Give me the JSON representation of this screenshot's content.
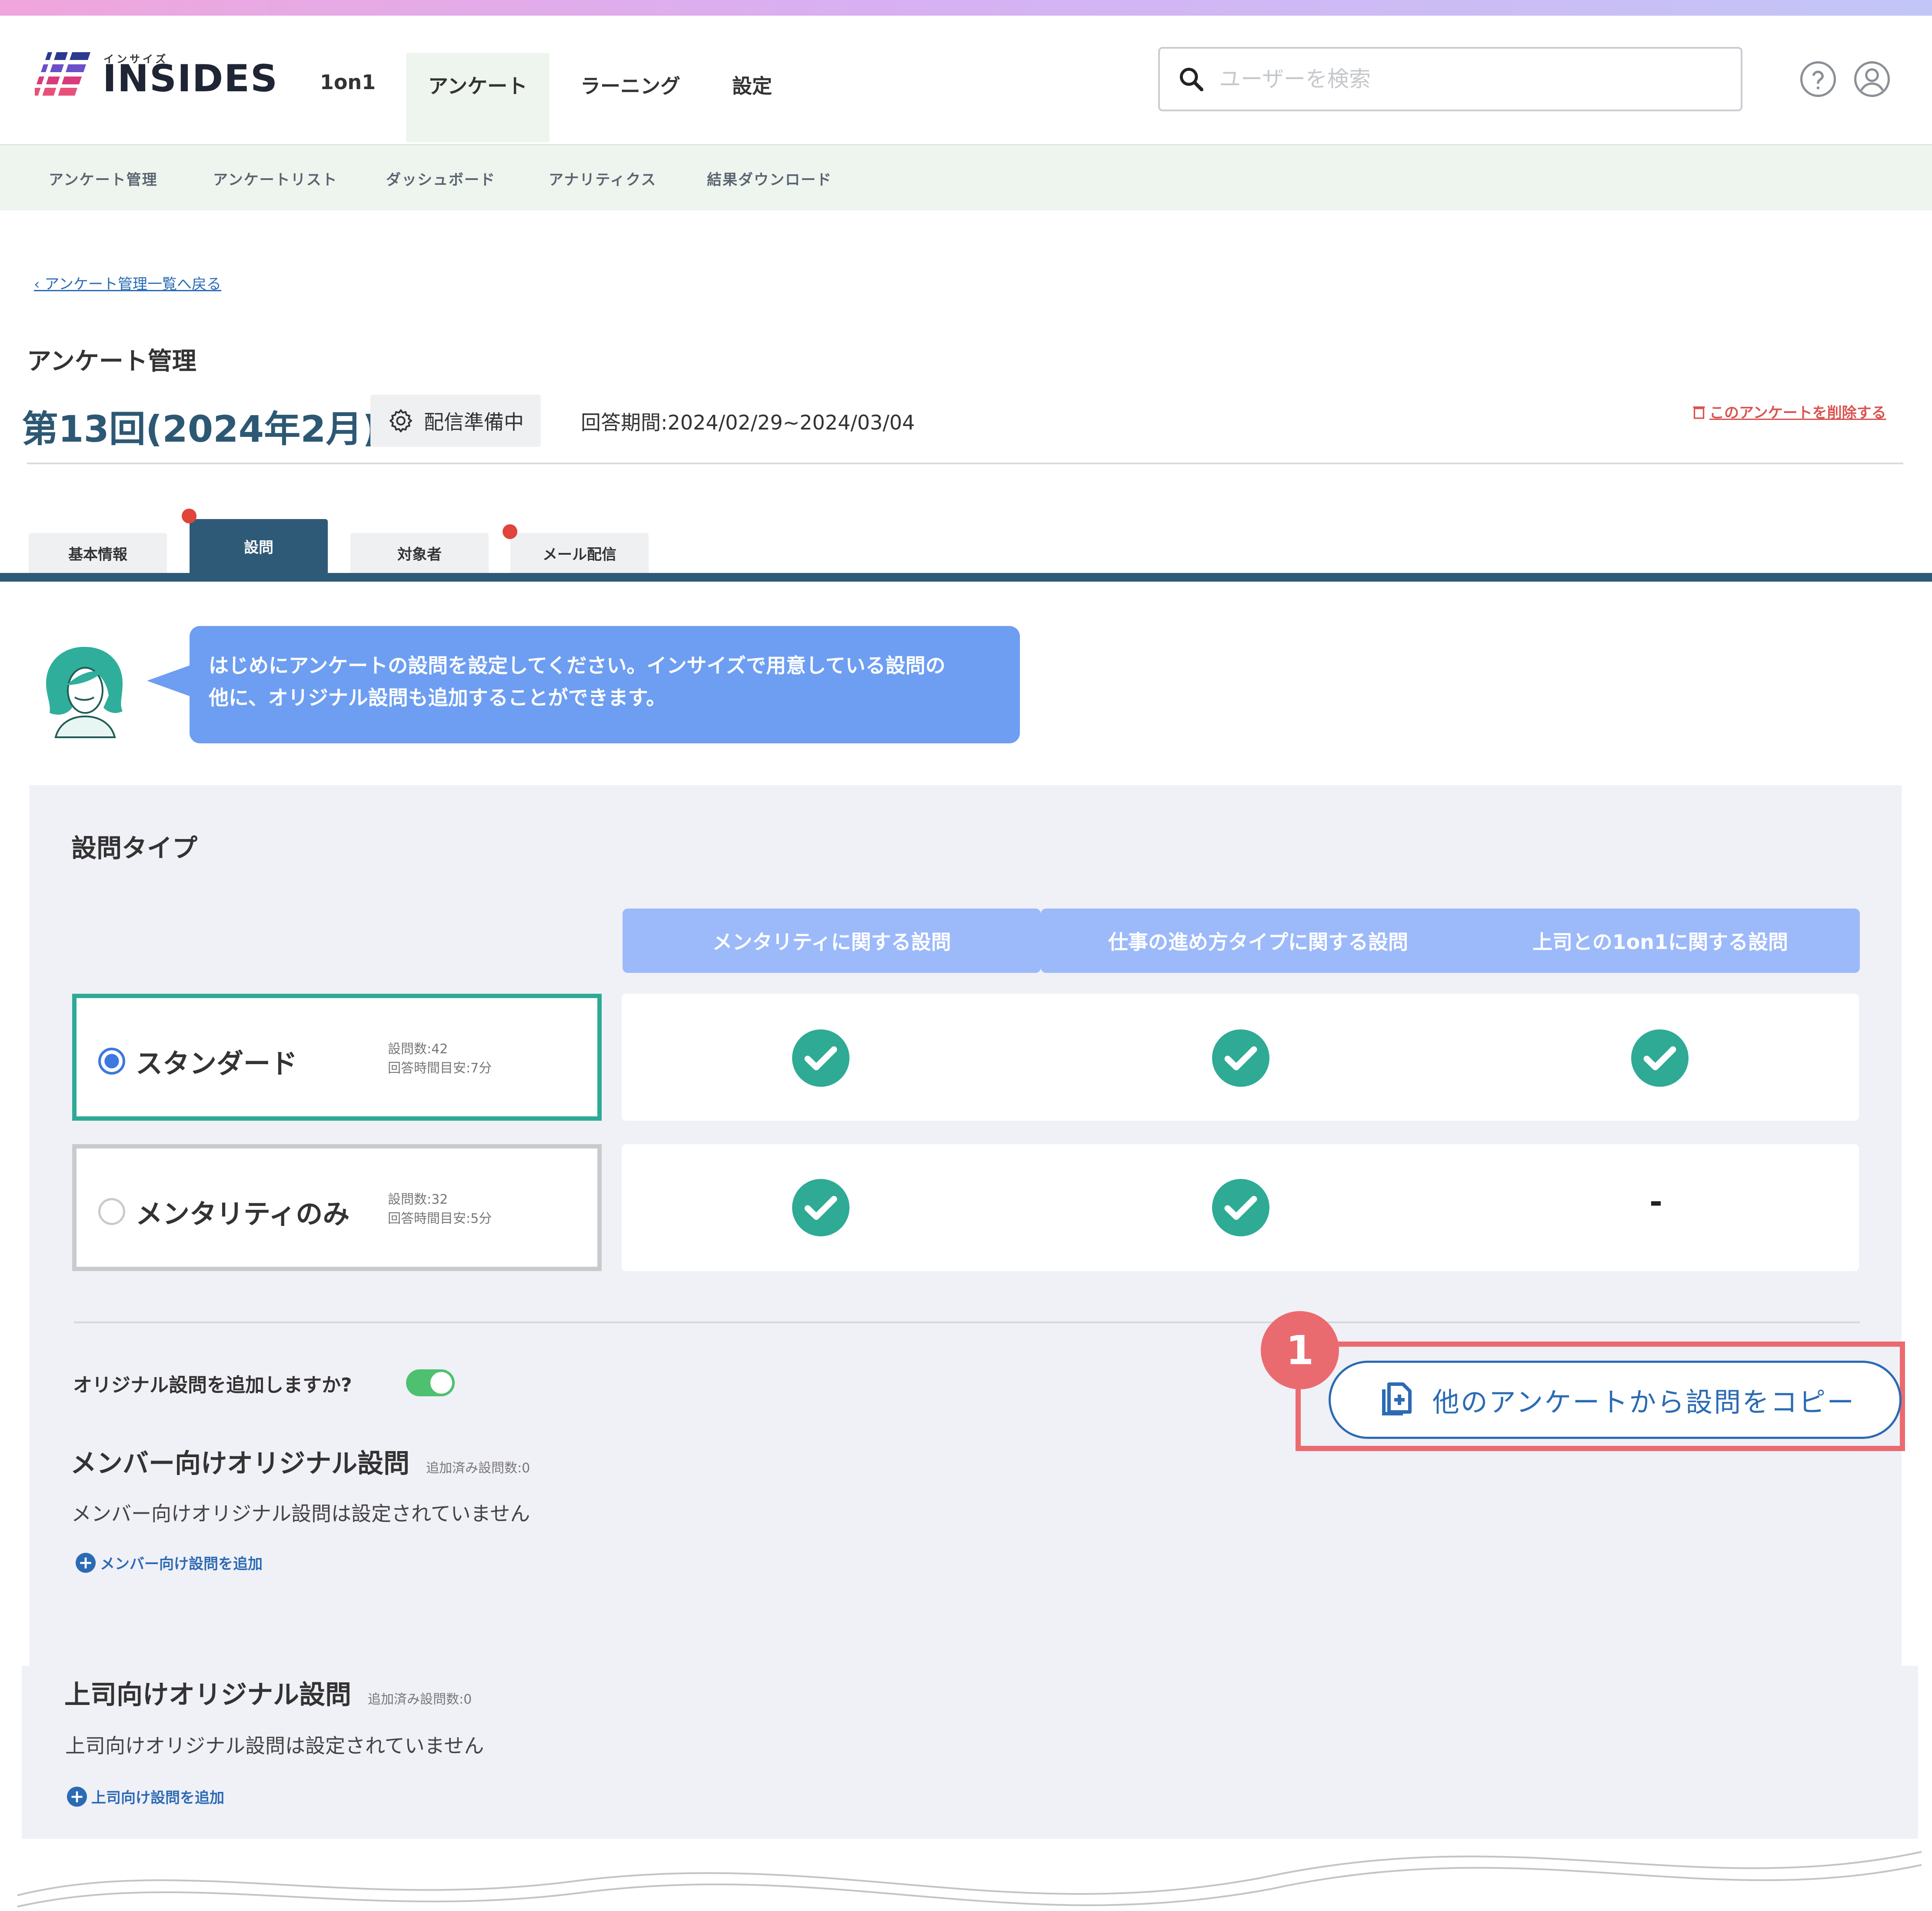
{
  "header": {
    "logo_text": "INSIDES",
    "logo_sub": "インサイズ",
    "nav": [
      "1on1",
      "アンケート",
      "ラーニング",
      "設定"
    ],
    "search_placeholder": "ユーザーを検索",
    "help_icon": "help-circle-icon",
    "user_icon": "user-circle-icon"
  },
  "subnav": [
    "アンケート管理",
    "アンケートリスト",
    "ダッシュボード",
    "アナリティクス",
    "結果ダウンロード"
  ],
  "breadcrumb": "‹ アンケート管理一覧へ戻る",
  "page_label": "アンケート管理",
  "survey": {
    "title": "第13回(2024年2月)",
    "status": "配信準備中",
    "period": "回答期間:2024/02/29~2024/03/04",
    "delete_link": "このアンケートを削除する"
  },
  "tabs": [
    "基本情報",
    "設問",
    "対象者",
    "メール配信"
  ],
  "guide_message_line1": "はじめにアンケートの設問を設定してください。インサイズで用意している設問の",
  "guide_message_line2": "他に、オリジナル設問も追加することができます。",
  "question_type": {
    "title": "設問タイプ",
    "columns": [
      "メンタリティに関する設問",
      "仕事の進め方タイプに関する設問",
      "上司との1on1に関する設問"
    ],
    "options": [
      {
        "label": "スタンダード",
        "count": "設問数:42",
        "time": "回答時間目安:7分",
        "selected": true,
        "cells": [
          "check",
          "check",
          "check"
        ]
      },
      {
        "label": "メンタリティのみ",
        "count": "設問数:32",
        "time": "回答時間目安:5分",
        "selected": false,
        "cells": [
          "check",
          "check",
          "-"
        ]
      }
    ]
  },
  "original": {
    "toggle_label": "オリジナル設問を追加しますか?",
    "toggle_on": true,
    "copy_button": "他のアンケートから設問をコピー",
    "step_number": "1",
    "member": {
      "title": "メンバー向けオリジナル設問",
      "count": "追加済み設問数:0",
      "empty": "メンバー向けオリジナル設問は設定されていません",
      "add": "メンバー向け設問を追加"
    },
    "boss": {
      "title": "上司向けオリジナル設問",
      "count": "追加済み設問数:0",
      "empty": "上司向けオリジナル設問は設定されていません",
      "add": "上司向け設問を追加"
    }
  },
  "colors": {
    "accent": "#2f5a77",
    "teal": "#2eaa95",
    "highlight": "#ea6b6f",
    "link": "#2b6bb3"
  }
}
